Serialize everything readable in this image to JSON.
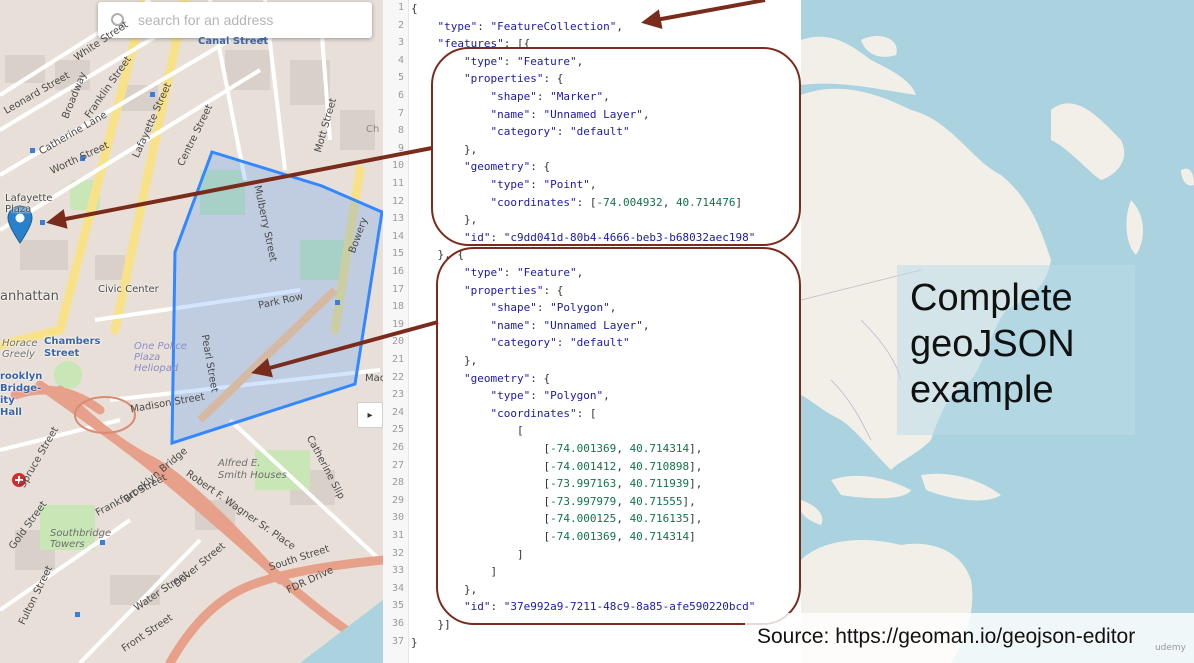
{
  "search": {
    "placeholder": "search for an address"
  },
  "map_labels": [
    {
      "id": "canal-street",
      "text": "Canal Street"
    },
    {
      "id": "white-street",
      "text": "White Street"
    },
    {
      "id": "broadway",
      "text": "Broadway"
    },
    {
      "id": "leonard-street",
      "text": "Leonard Street"
    },
    {
      "id": "franklin-street",
      "text": "Franklin Street"
    },
    {
      "id": "lafayette-street",
      "text": "Lafayette Street"
    },
    {
      "id": "centre-street",
      "text": "Centre Street"
    },
    {
      "id": "catherine-lane",
      "text": "Catherine Lane"
    },
    {
      "id": "worth-street",
      "text": "Worth Street"
    },
    {
      "id": "lafayette-plaza",
      "text": "Lafayette Plaza"
    },
    {
      "id": "mulberry-street",
      "text": "Mulberry Street"
    },
    {
      "id": "mott-street",
      "text": "Mott Street"
    },
    {
      "id": "bowery",
      "text": "Bowery"
    },
    {
      "id": "civic-center",
      "text": "Civic Center"
    },
    {
      "id": "manhattan",
      "text": "anhattan"
    },
    {
      "id": "park-row",
      "text": "Park Row"
    },
    {
      "id": "pearl-street",
      "text": "Pearl Street"
    },
    {
      "id": "horace-greeley",
      "text": "Horace Greely"
    },
    {
      "id": "chambers-street",
      "text": "Chambers Street"
    },
    {
      "id": "one-police-plaza",
      "text": "One Police Plaza Heliopad"
    },
    {
      "id": "brooklyn-bridge-city-hall",
      "text": "rooklyn Bridge-ity Hall"
    },
    {
      "id": "madison-street",
      "text": "Madison Street"
    },
    {
      "id": "alfred-smith",
      "text": "Alfred E. Smith Houses"
    },
    {
      "id": "catherine-slip",
      "text": "Catherine Slip"
    },
    {
      "id": "spruce-street",
      "text": "Spruce Street"
    },
    {
      "id": "southbridge-towers",
      "text": "Southbridge Towers"
    },
    {
      "id": "frankfort-street",
      "text": "Frankfort Street"
    },
    {
      "id": "brooklyn-bridge",
      "text": "Brooklyn Bridge"
    },
    {
      "id": "robert-wagner",
      "text": "Robert F. Wagner Sr. Place"
    },
    {
      "id": "south-street",
      "text": "South Street"
    },
    {
      "id": "fdr-drive",
      "text": "FDR Drive"
    },
    {
      "id": "water-street",
      "text": "Water Street"
    },
    {
      "id": "dover-street",
      "text": "Dover Street"
    },
    {
      "id": "front-street",
      "text": "Front Street"
    },
    {
      "id": "gold-street",
      "text": "Gold Street"
    },
    {
      "id": "fulton-street",
      "text": "Fulton Street"
    },
    {
      "id": "mac",
      "text": "Mac"
    },
    {
      "id": "ch",
      "text": "Ch"
    }
  ],
  "editor": {
    "lines": [
      {
        "n": "1",
        "t": "{"
      },
      {
        "n": "2",
        "t": "    \"type\": \"FeatureCollection\","
      },
      {
        "n": "3",
        "t": "    \"features\": [{"
      },
      {
        "n": "4",
        "t": "        \"type\": \"Feature\","
      },
      {
        "n": "5",
        "t": "        \"properties\": {"
      },
      {
        "n": "6",
        "t": "            \"shape\": \"Marker\","
      },
      {
        "n": "7",
        "t": "            \"name\": \"Unnamed Layer\","
      },
      {
        "n": "8",
        "t": "            \"category\": \"default\""
      },
      {
        "n": "9",
        "t": "        },"
      },
      {
        "n": "10",
        "t": "        \"geometry\": {"
      },
      {
        "n": "11",
        "t": "            \"type\": \"Point\","
      },
      {
        "n": "12",
        "t": "            \"coordinates\": [-74.004932, 40.714476]"
      },
      {
        "n": "13",
        "t": "        },"
      },
      {
        "n": "14",
        "t": "        \"id\": \"c9dd041d-80b4-4666-beb3-b68032aec198\""
      },
      {
        "n": "15",
        "t": "    }, {"
      },
      {
        "n": "16",
        "t": "        \"type\": \"Feature\","
      },
      {
        "n": "17",
        "t": "        \"properties\": {"
      },
      {
        "n": "18",
        "t": "            \"shape\": \"Polygon\","
      },
      {
        "n": "19",
        "t": "            \"name\": \"Unnamed Layer\","
      },
      {
        "n": "20",
        "t": "            \"category\": \"default\""
      },
      {
        "n": "21",
        "t": "        },"
      },
      {
        "n": "22",
        "t": "        \"geometry\": {"
      },
      {
        "n": "23",
        "t": "            \"type\": \"Polygon\","
      },
      {
        "n": "24",
        "t": "            \"coordinates\": ["
      },
      {
        "n": "25",
        "t": "                ["
      },
      {
        "n": "26",
        "t": "                    [-74.001369, 40.714314],"
      },
      {
        "n": "27",
        "t": "                    [-74.001412, 40.710898],"
      },
      {
        "n": "28",
        "t": "                    [-73.997163, 40.711939],"
      },
      {
        "n": "29",
        "t": "                    [-73.997979, 40.71555],"
      },
      {
        "n": "30",
        "t": "                    [-74.000125, 40.716135],"
      },
      {
        "n": "31",
        "t": "                    [-74.001369, 40.714314]"
      },
      {
        "n": "32",
        "t": "                ]"
      },
      {
        "n": "33",
        "t": "            ]"
      },
      {
        "n": "34",
        "t": "        },"
      },
      {
        "n": "35",
        "t": "        \"id\": \"37e992a9-7211-48c9-8a85-afe590220bcd\""
      },
      {
        "n": "36",
        "t": "    }]"
      },
      {
        "n": "37",
        "t": "}"
      }
    ]
  },
  "slide": {
    "title": "Complete\ngeoJSON\nexample",
    "source": "Source: https://geoman.io/geojson-editor",
    "watermark": "udemy"
  },
  "colors": {
    "arrow": "#7a2c1c",
    "polygon": "#3388ff",
    "marker": "#2a81cb",
    "water": "#aad3df",
    "land": "#f2efe9"
  }
}
